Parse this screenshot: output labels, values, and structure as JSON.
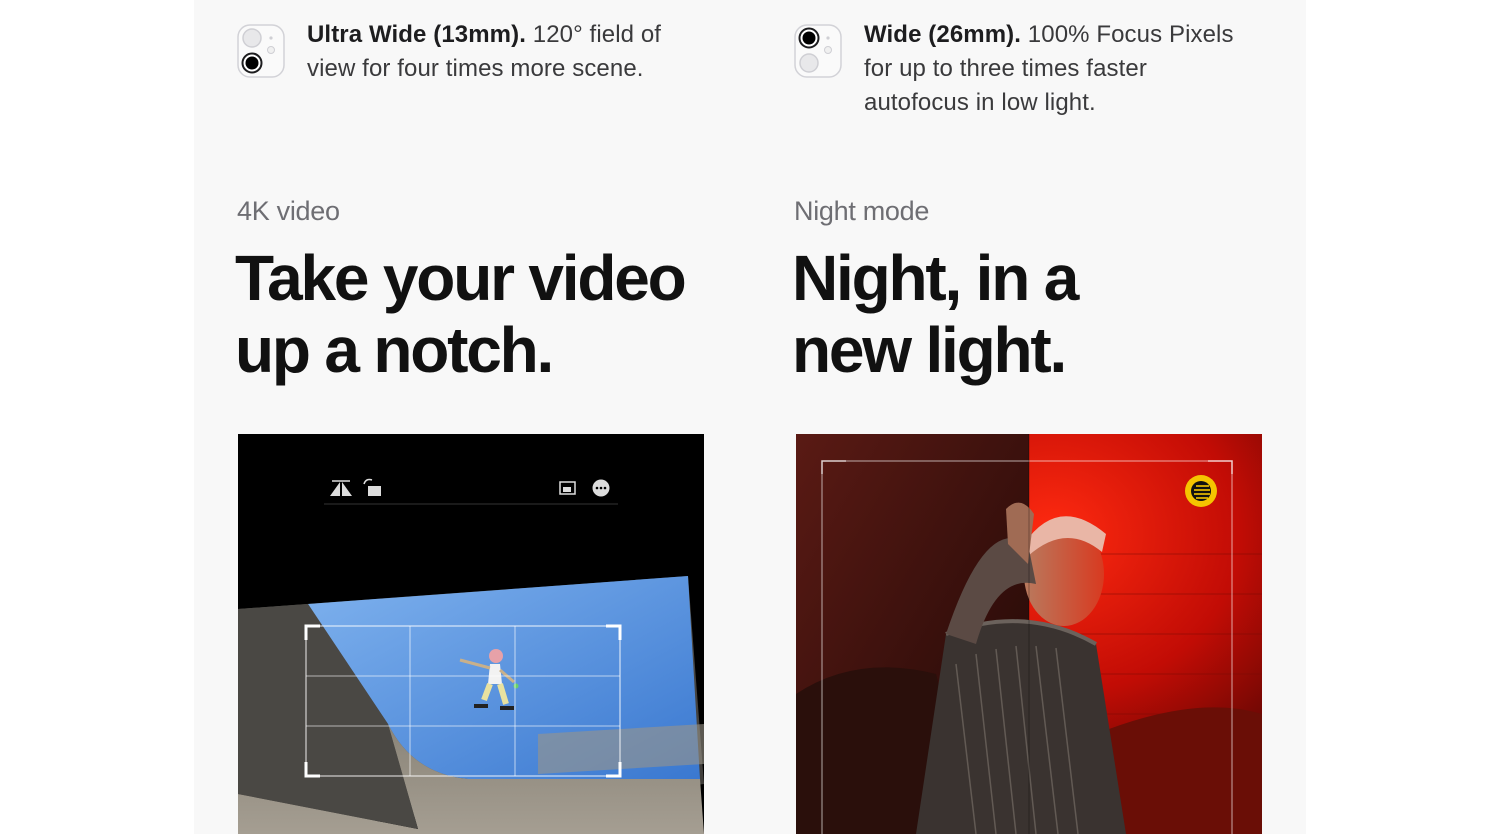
{
  "lenses": [
    {
      "name": "Ultra Wide (13mm).",
      "line1": "120° field of",
      "line2": "view for four times more scene.",
      "line3": "",
      "icon": "ultra-wide-lens-icon"
    },
    {
      "name": "Wide (26mm).",
      "line1": "100% Focus Pixels",
      "line2": "for up to three times faster",
      "line3": "autofocus in low light.",
      "icon": "wide-lens-icon"
    }
  ],
  "features": [
    {
      "eyebrow": "4K video",
      "headline_line1": "Take your video",
      "headline_line2": "up a notch.",
      "image": "skateboarder-video-edit-screenshot"
    },
    {
      "eyebrow": "Night mode",
      "headline_line1": "Night, in a",
      "headline_line2": "new light.",
      "image": "night-mode-portrait-photo"
    }
  ],
  "colors": {
    "panel": "#f8f8f8",
    "headline": "#111111",
    "eyebrow": "#6e6e73",
    "night_mode_badge": "#f5c400"
  }
}
